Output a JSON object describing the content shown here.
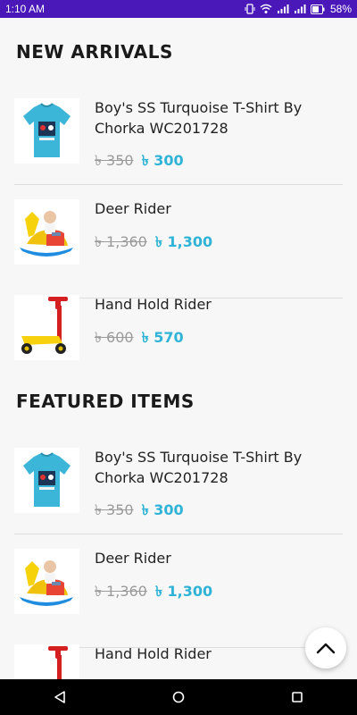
{
  "status_bar": {
    "time": "1:10 AM",
    "battery_percent": "58%",
    "icons": [
      "vibrate-icon",
      "wifi-icon",
      "signal-icon",
      "signal-icon",
      "battery-icon"
    ]
  },
  "sections": [
    {
      "title": "NEW ARRIVALS",
      "products": [
        {
          "name": "Boy's SS Turquoise T-Shirt By Chorka WC201728",
          "old_price": "৳ 350",
          "new_price": "৳ 300",
          "image": "tshirt"
        },
        {
          "name": "Deer Rider",
          "old_price": "৳ 1,360",
          "new_price": "৳ 1,300",
          "image": "deer-rider"
        },
        {
          "name": "Hand Hold Rider",
          "old_price": "৳ 600",
          "new_price": "৳ 570",
          "image": "scooter"
        }
      ]
    },
    {
      "title": "FEATURED ITEMS",
      "products": [
        {
          "name": "Boy's SS Turquoise T-Shirt By Chorka WC201728",
          "old_price": "৳ 350",
          "new_price": "৳ 300",
          "image": "tshirt"
        },
        {
          "name": "Deer Rider",
          "old_price": "৳ 1,360",
          "new_price": "৳ 1,300",
          "image": "deer-rider"
        },
        {
          "name": "Hand Hold Rider",
          "old_price": "",
          "new_price": "",
          "image": "scooter"
        }
      ]
    }
  ],
  "scroll_top_icon": "chevron-up-icon",
  "nav_bar": [
    "back-icon",
    "home-icon",
    "recents-icon"
  ],
  "colors": {
    "status_bar": "#4a17b8",
    "price_accent": "#2fb3d6",
    "old_price": "#9b9b9b"
  }
}
